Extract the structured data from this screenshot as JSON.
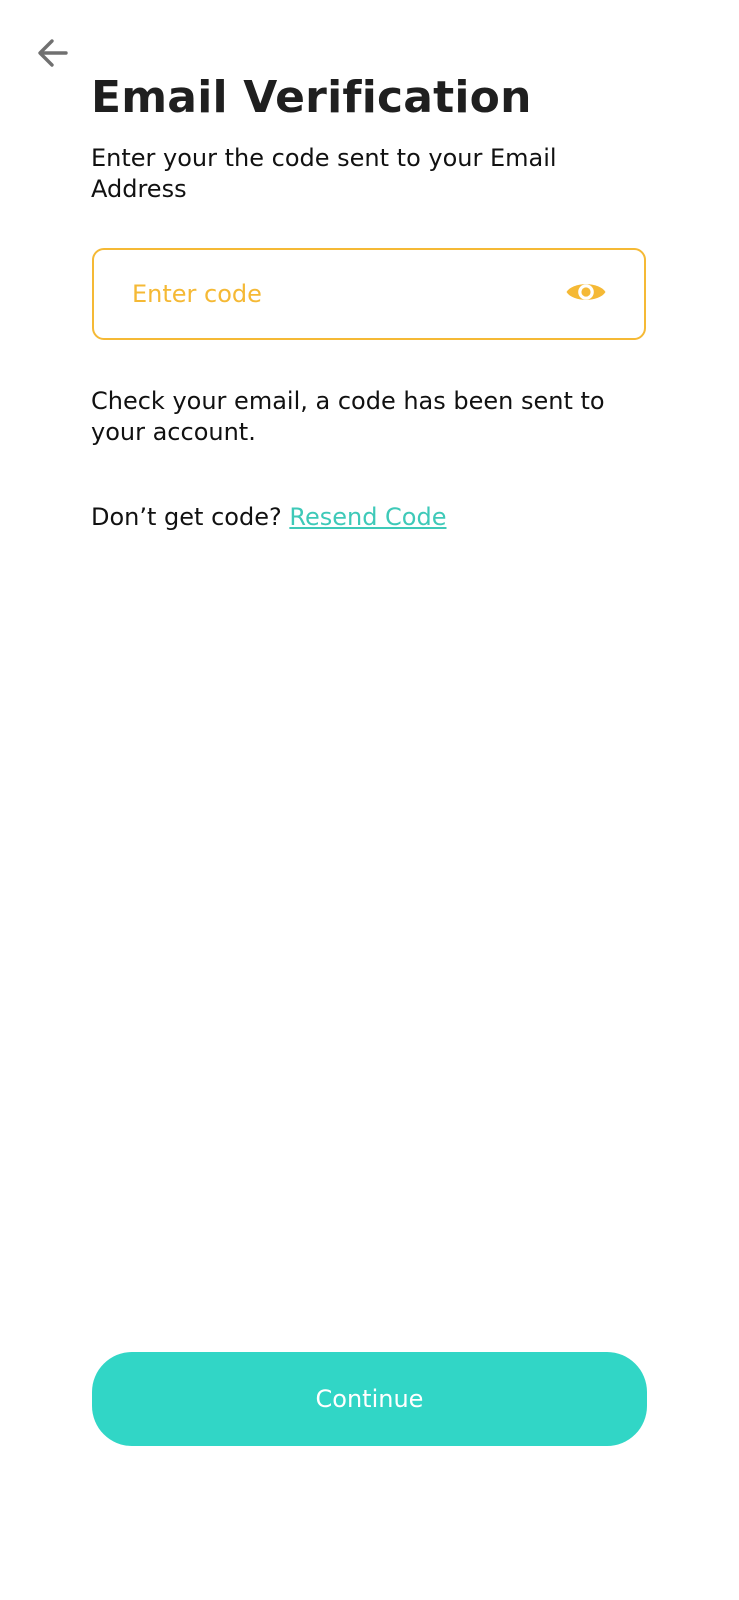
{
  "header": {
    "back_icon": "arrow-left-icon",
    "title": "Email Verification",
    "subtitle": "Enter your the code sent to your Email Address"
  },
  "code_field": {
    "placeholder": "Enter code",
    "value": "",
    "toggle_icon": "eye-icon"
  },
  "info": {
    "message": "Check your email, a code has been sent to your account.",
    "resend_prompt": "Don’t get code?",
    "resend_link": "Resend Code"
  },
  "footer": {
    "continue_label": "Continue"
  },
  "colors": {
    "accent_yellow": "#f5b935",
    "accent_teal": "#31d6c6",
    "link_teal": "#3ec9b8",
    "text": "#111111"
  }
}
